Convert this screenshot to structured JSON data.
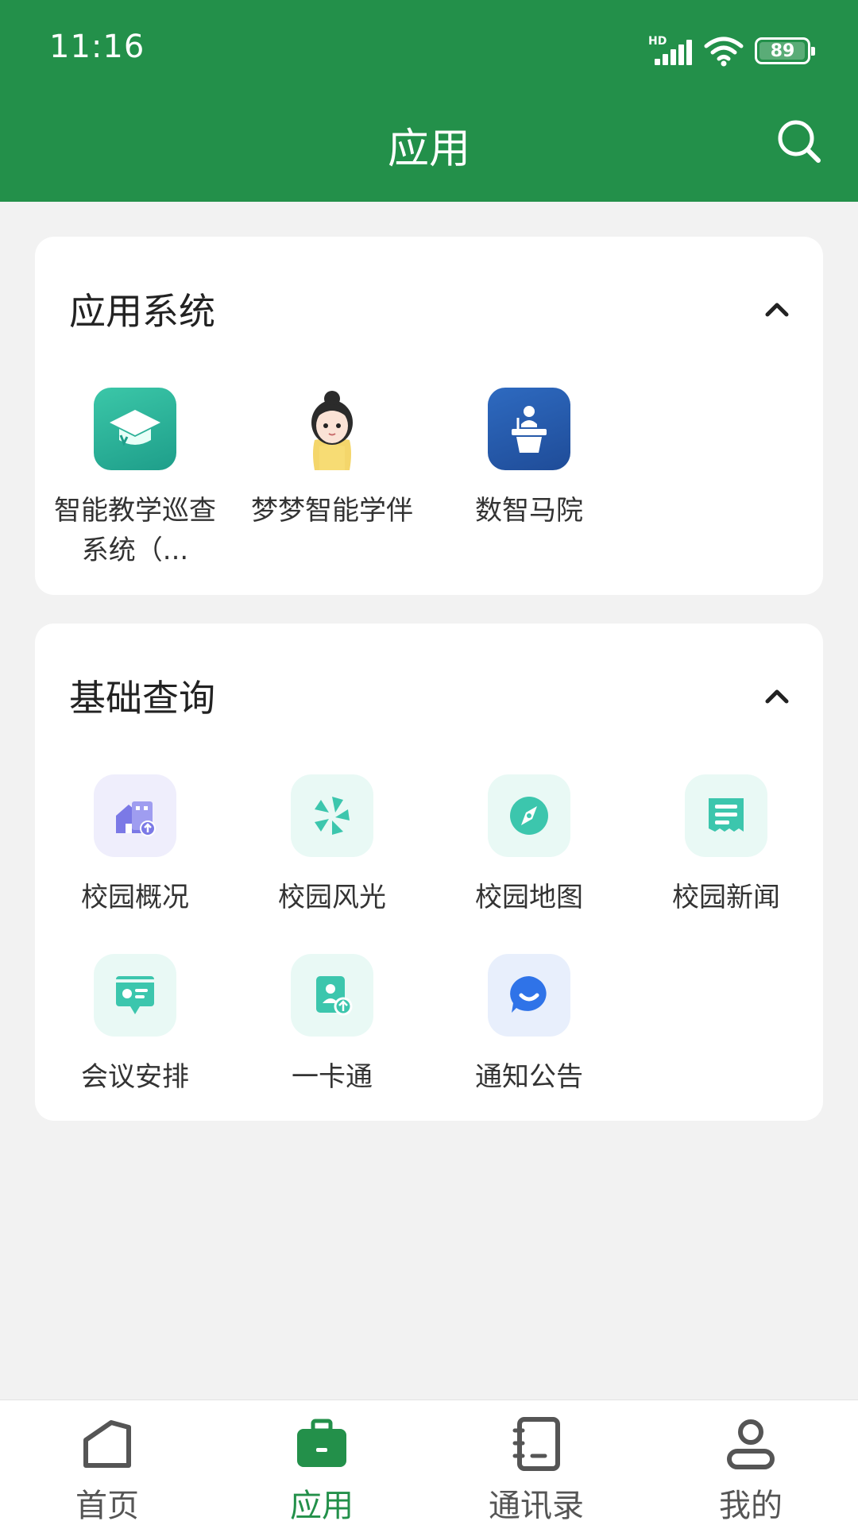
{
  "status_bar": {
    "time": "11:16",
    "network": "HD",
    "battery": "89"
  },
  "header": {
    "title": "应用"
  },
  "sections": [
    {
      "title": "应用系统",
      "apps": [
        {
          "label": "智能教学巡查系统（...",
          "icon": "graduation-cap-icon"
        },
        {
          "label": "梦梦智能学伴",
          "icon": "girl-avatar-icon"
        },
        {
          "label": "数智马院",
          "icon": "podium-speaker-icon"
        }
      ]
    },
    {
      "title": "基础查询",
      "apps": [
        {
          "label": "校园概况",
          "icon": "campus-building-icon"
        },
        {
          "label": "校园风光",
          "icon": "aperture-icon"
        },
        {
          "label": "校园地图",
          "icon": "compass-icon"
        },
        {
          "label": "校园新闻",
          "icon": "newspaper-icon"
        },
        {
          "label": "会议安排",
          "icon": "presentation-board-icon"
        },
        {
          "label": "一卡通",
          "icon": "id-card-icon"
        },
        {
          "label": "通知公告",
          "icon": "chat-bubble-icon"
        }
      ]
    }
  ],
  "bottom_nav": [
    {
      "label": "首页",
      "icon": "home-icon",
      "active": false
    },
    {
      "label": "应用",
      "icon": "briefcase-icon",
      "active": true
    },
    {
      "label": "通讯录",
      "icon": "address-book-icon",
      "active": false
    },
    {
      "label": "我的",
      "icon": "user-icon",
      "active": false
    }
  ],
  "colors": {
    "primary": "#23904a",
    "teal": "#3cc6ad",
    "purple": "#7b79e6",
    "blue": "#2f73e8",
    "navy": "#2656a8"
  }
}
